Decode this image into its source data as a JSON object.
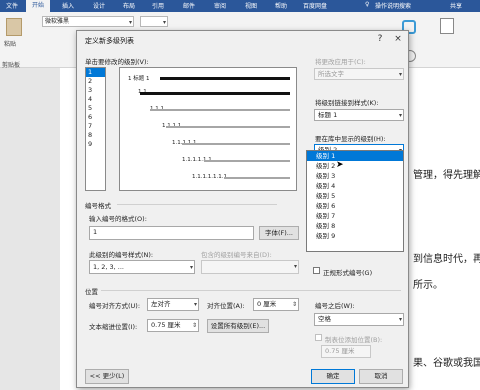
{
  "ribbon": {
    "tabs": [
      "文件",
      "开始",
      "插入",
      "设计",
      "布局",
      "引用",
      "邮件",
      "审阅",
      "视图",
      "帮助",
      "百度网盘",
      "操作说明搜索",
      "共享"
    ],
    "font_name": "微软雅黑",
    "clipboard": [
      "粘贴",
      "剪贴板"
    ]
  },
  "document": {
    "lines": [
      "管理，得先理解",
      "到信息时代，再",
      "所示。",
      "果、谷歌或我国"
    ]
  },
  "dialog": {
    "title": "定义新多级列表",
    "help_icon": "?",
    "close_icon": "×",
    "section_click_level": "单击要修改的级别(V):",
    "levels": [
      "1",
      "2",
      "3",
      "4",
      "5",
      "6",
      "7",
      "8",
      "9"
    ],
    "selected_level": "1",
    "preview_rows": [
      {
        "label": "1 标题 1",
        "dark": true
      },
      {
        "label": "1.1",
        "dark": true
      },
      {
        "label": "1.1.1",
        "dark": false
      },
      {
        "label": "1.1.1.1",
        "dark": false
      },
      {
        "label": "1.1.1.1.1",
        "dark": false
      },
      {
        "label": "1.1.1.1.1.1",
        "dark": false
      },
      {
        "label": "1.1.1.1.1.1.1",
        "dark": false
      },
      {
        "label": "1.1.1.1.1.1.1.1",
        "dark": false
      },
      {
        "label": "1.1.1.1.1.1.1.1.1",
        "dark": false
      }
    ],
    "apply_changes_label": "将更改应用于(C):",
    "apply_changes_value": "所选文字",
    "link_style_label": "将级别链接到样式(K):",
    "link_style_value": "标题 1",
    "gallery_level_label": "要在库中显示的级别(H):",
    "gallery_level_value": "级别 2",
    "gallery_level_options": [
      "级别 1",
      "级别 2",
      "级别 3",
      "级别 4",
      "级别 5",
      "级别 6",
      "级别 7",
      "级别 8",
      "级别 9"
    ],
    "gallery_level_highlighted": "级别 1",
    "number_format_section": "编号格式",
    "enter_format_label": "输入编号的格式(O):",
    "enter_format_value": "1",
    "font_button": "字体(F)...",
    "level_style_label": "此级别的编号样式(N):",
    "level_style_value": "1, 2, 3, ...",
    "include_level_label": "包含的级别编号来自(D):",
    "legal_style_label": "正规形式编号(G)",
    "position_section": "位置",
    "alignment_label": "编号对齐方式(U):",
    "alignment_value": "左对齐",
    "aligned_at_label": "对齐位置(A):",
    "aligned_at_value": "0 厘米",
    "indent_label": "文本缩进位置(I):",
    "indent_value": "0.75 厘米",
    "set_all_levels_button": "设置所有级别(E)...",
    "follow_with_label": "编号之后(W):",
    "follow_with_value": "空格",
    "tab_stop_label": "制表位添加位置(B):",
    "tab_stop_value": "0.75 厘米",
    "less_button": "<< 更少(L)",
    "ok_button": "确定",
    "cancel_button": "取消"
  }
}
